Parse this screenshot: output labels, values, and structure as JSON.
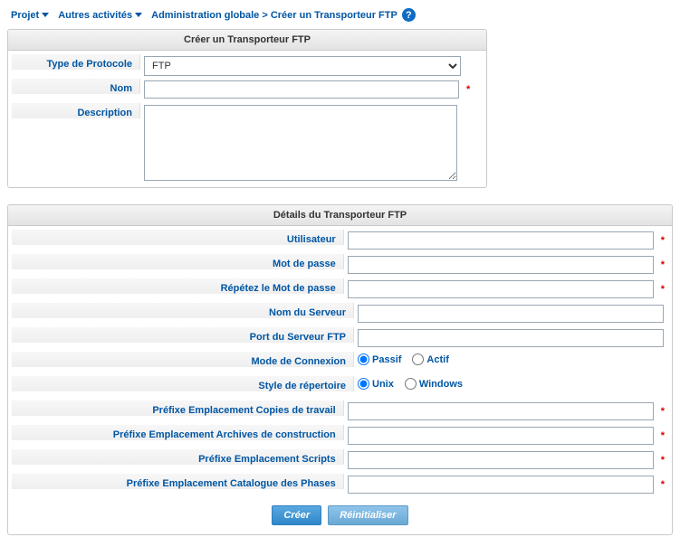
{
  "topbar": {
    "project": "Projet",
    "other": "Autres activités",
    "breadcrumb": "Administration globale > Créer un Transporteur FTP"
  },
  "panel_create": {
    "title": "Créer un Transporteur FTP",
    "protocol_label": "Type de Protocole",
    "protocol_value": "FTP",
    "name_label": "Nom",
    "name_value": "",
    "desc_label": "Description",
    "desc_value": ""
  },
  "panel_details": {
    "title": "Détails du Transporteur FTP",
    "user_label": "Utilisateur",
    "user_value": "",
    "pass_label": "Mot de passe",
    "pass_value": "",
    "pass2_label": "Répétez le Mot de passe",
    "pass2_value": "",
    "server_label": "Nom du Serveur",
    "server_value": "",
    "port_label": "Port du Serveur FTP",
    "port_value": "",
    "connmode_label": "Mode de Connexion",
    "connmode_opt1": "Passif",
    "connmode_opt2": "Actif",
    "dirstyle_label": "Style de répertoire",
    "dirstyle_opt1": "Unix",
    "dirstyle_opt2": "Windows",
    "prefix_work_label": "Préfixe Emplacement Copies de travail",
    "prefix_work_value": "",
    "prefix_build_label": "Préfixe Emplacement Archives de construction",
    "prefix_build_value": "",
    "prefix_scripts_label": "Préfixe Emplacement Scripts",
    "prefix_scripts_value": "",
    "prefix_phases_label": "Préfixe Emplacement Catalogue des Phases",
    "prefix_phases_value": ""
  },
  "buttons": {
    "create": "Créer",
    "reset": "Réinitialiser"
  }
}
